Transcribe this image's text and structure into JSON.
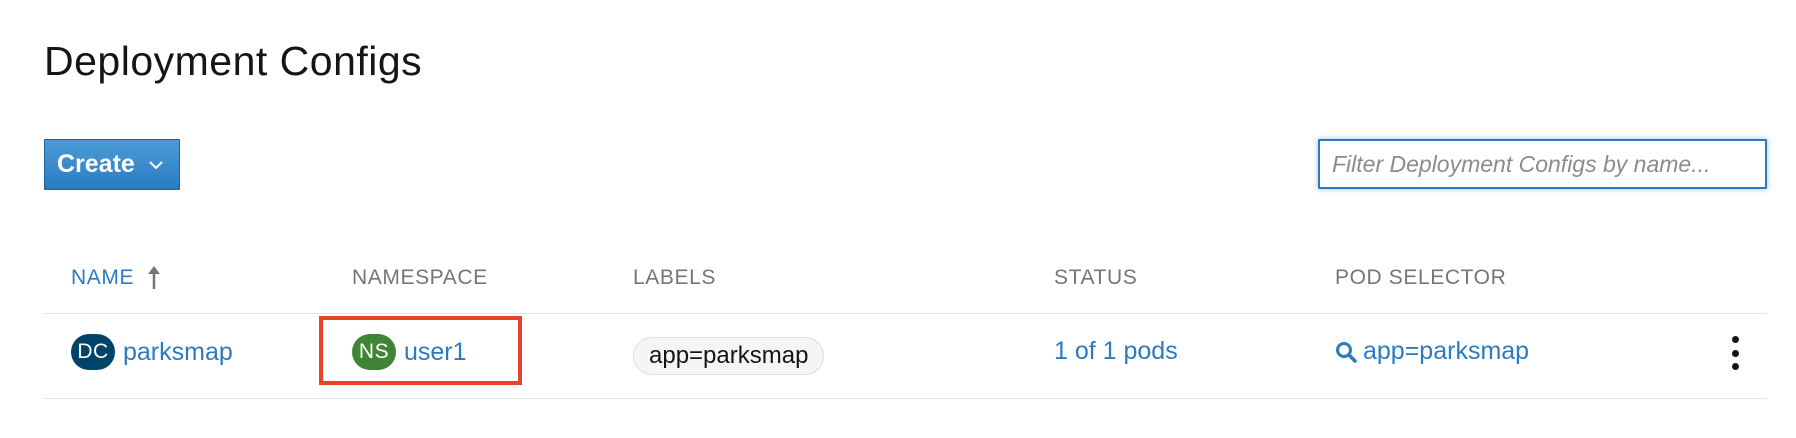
{
  "page": {
    "title": "Deployment Configs"
  },
  "toolbar": {
    "create_label": "Create",
    "filter_placeholder": "Filter Deployment Configs by name..."
  },
  "table": {
    "columns": [
      "NAME",
      "NAMESPACE",
      "LABELS",
      "STATUS",
      "POD SELECTOR"
    ],
    "sort_column": "NAME",
    "sort_direction": "ascending",
    "rows": [
      {
        "kind_badge": "DC",
        "name": "parksmap",
        "namespace_badge": "NS",
        "namespace": "user1",
        "labels": [
          "app=parksmap"
        ],
        "status": "1 of 1 pods",
        "pod_selector": "app=parksmap"
      }
    ]
  },
  "colors": {
    "accent": "#2a7bc2",
    "dc_badge": "#004368",
    "ns_badge": "#3e8635",
    "highlight": "#e8432a"
  },
  "icons": [
    "chevron-down-icon",
    "sort-ascending-icon",
    "search-icon",
    "kebab-menu-icon"
  ]
}
